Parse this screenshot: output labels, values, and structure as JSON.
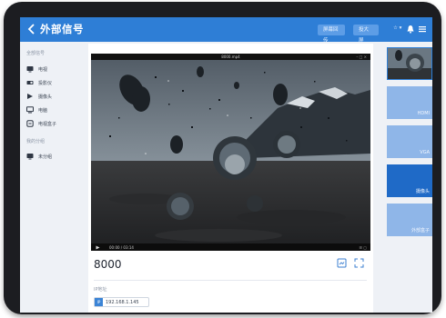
{
  "header": {
    "title": "外部信号",
    "button1": "屏幕回传",
    "button2": "投大屏",
    "user": "☆ ▾"
  },
  "sidebar": {
    "section1": "全部信号",
    "items": [
      {
        "label": "电视",
        "icon": "tv-icon"
      },
      {
        "label": "投影仪",
        "icon": "projector-icon"
      },
      {
        "label": "摄像头",
        "icon": "camera-icon"
      },
      {
        "label": "电脑",
        "icon": "computer-icon"
      },
      {
        "label": "电视盒子",
        "icon": "set-top-box-icon"
      }
    ],
    "section2": "我的分组",
    "group_items": [
      {
        "label": "未分组",
        "icon": "group-icon"
      }
    ]
  },
  "video": {
    "title": "8000.mp4",
    "time": "00:00 / 03:14",
    "progress": 0.14,
    "controls_right": "☰ ▢"
  },
  "main": {
    "channel_number": "8000",
    "field_label": "IP地址",
    "ip_tag": "IP",
    "ip_value": "192.168.1.145"
  },
  "thumbnails": [
    {
      "label": ""
    },
    {
      "label": "HDMI"
    },
    {
      "label": "VGA"
    },
    {
      "label": "摄像头"
    },
    {
      "label": "外部盒子"
    }
  ],
  "colors": {
    "accent": "#2e7ed6",
    "thumb": "#8fb6e8",
    "thumb_selected": "#1f6ac7"
  }
}
